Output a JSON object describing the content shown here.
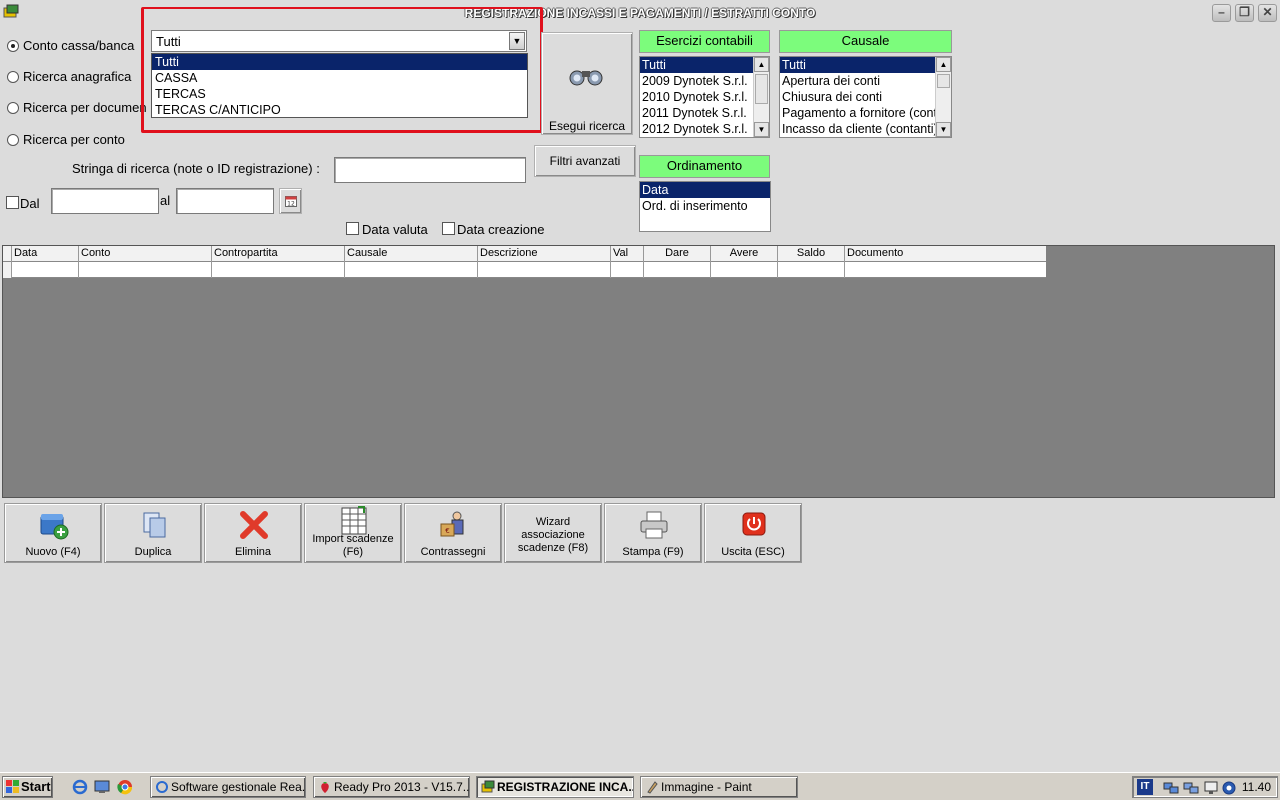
{
  "window": {
    "title": "REGISTRAZIONE INCASSI E PAGAMENTI / ESTRATTI CONTO"
  },
  "search_modes": [
    {
      "label": "Conto cassa/banca",
      "selected": true
    },
    {
      "label": "Ricerca anagrafica",
      "selected": false
    },
    {
      "label": "Ricerca per documen",
      "selected": false
    },
    {
      "label": "Ricerca per conto",
      "selected": false
    }
  ],
  "cash_account_combo": {
    "value": "Tutti",
    "options": [
      "Tutti",
      "CASSA",
      "TERCAS",
      "TERCAS C/ANTICIPO"
    ],
    "selected_index": 0
  },
  "search_button": {
    "label": "Esegui ricerca"
  },
  "advanced_filters_button": {
    "label": "Filtri avanzati"
  },
  "fiscal_years": {
    "header": "Esercizi contabili",
    "items": [
      "Tutti",
      "2009 Dynotek S.r.l.",
      "2010 Dynotek S.r.l.",
      "2011 Dynotek S.r.l.",
      "2012 Dynotek S.r.l."
    ]
  },
  "causale": {
    "header": "Causale",
    "items": [
      "Tutti",
      "Apertura dei conti",
      "Chiusura dei conti",
      "Pagamento a fornitore (contanti)",
      "Incasso da cliente (contanti)"
    ]
  },
  "ordering": {
    "header": "Ordinamento",
    "items": [
      "Data",
      "Ord. di inserimento"
    ]
  },
  "search_string": {
    "label": "Stringa di ricerca (note o ID registrazione) :",
    "value": ""
  },
  "date_range": {
    "from_label": "Dal",
    "to_label": "al",
    "from_value": "",
    "to_value": ""
  },
  "date_options": {
    "value_date_label": "Data valuta",
    "creation_date_label": "Data creazione"
  },
  "grid": {
    "columns": [
      "Data",
      "Conto",
      "Contropartita",
      "Causale",
      "Descrizione",
      "Val",
      "Dare",
      "Avere",
      "Saldo",
      "Documento"
    ]
  },
  "actions": [
    {
      "label": "Nuovo (F4)",
      "icon": "new-record-icon"
    },
    {
      "label": "Duplica",
      "icon": "duplicate-icon"
    },
    {
      "label": "Elimina",
      "icon": "delete-x-icon"
    },
    {
      "label": "Import scadenze (F6)",
      "icon": "import-spreadsheet-icon"
    },
    {
      "label": "Contrassegni",
      "icon": "courier-icon"
    },
    {
      "label": "Wizard associazione scadenze (F8)",
      "icon": ""
    },
    {
      "label": "Stampa (F9)",
      "icon": "printer-icon"
    },
    {
      "label": "Uscita (ESC)",
      "icon": "power-icon"
    }
  ],
  "taskbar": {
    "start_label": "Start",
    "tasks": [
      {
        "label": "Software gestionale Rea...",
        "active": false
      },
      {
        "label": "Ready Pro 2013 - V15.7....",
        "active": false
      },
      {
        "label": "REGISTRAZIONE INCA...",
        "active": true
      },
      {
        "label": "Immagine - Paint",
        "active": false
      }
    ],
    "language": "IT",
    "clock": "11.40"
  },
  "colors": {
    "selection": "#0a246a",
    "listbox_header": "#7cfc7c",
    "highlight_border": "#e0101c",
    "grid_background": "#808080"
  }
}
